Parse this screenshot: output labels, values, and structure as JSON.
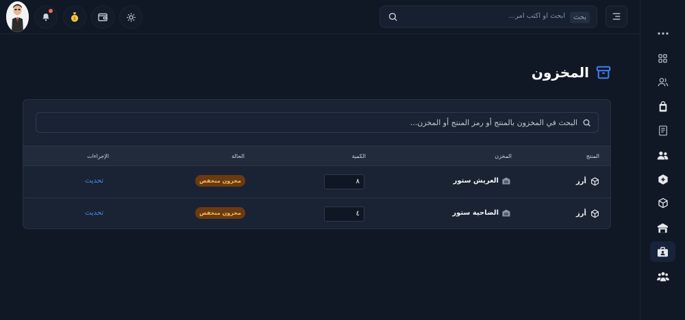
{
  "topbar": {
    "search_placeholder": "ابحث او اكتب امر...",
    "search_badge": "بحث",
    "icons": [
      "sun-icon",
      "wallet-icon",
      "coin-icon",
      "bell-icon",
      "menu-icon",
      "search-icon"
    ]
  },
  "page": {
    "title": "المخزون",
    "search_placeholder": "البحث في المخزون بالمنتج أو رمز المنتج أو المخزن..."
  },
  "table": {
    "headers": {
      "product": "المنتج",
      "warehouse": "المخزن",
      "quantity": "الكمية",
      "status": "الحالة",
      "actions": "الإجراءات"
    },
    "rows": [
      {
        "product": "أرز",
        "warehouse": "العريش ستور",
        "quantity": "٨",
        "status": "مخزون منخفض",
        "action": "تحديث"
      },
      {
        "product": "أرز",
        "warehouse": "الضاحية ستور",
        "quantity": "٤",
        "status": "مخزون منخفض",
        "action": "تحديث"
      }
    ]
  },
  "sidebar": {
    "items": [
      "more-icon",
      "grid-icon",
      "users-outline-icon",
      "bag-icon",
      "document-icon",
      "users-icon",
      "box-plus-icon",
      "cube-icon",
      "warehouse-icon",
      "inventory-icon",
      "team-icon"
    ],
    "active": "inventory-icon"
  },
  "colors": {
    "background": "#101826",
    "card": "#1a2333",
    "accent": "#4b8cf0",
    "badge_bg": "#6b3a10",
    "badge_text": "#f7c05a",
    "notification_dot": "#ef6b4a"
  }
}
